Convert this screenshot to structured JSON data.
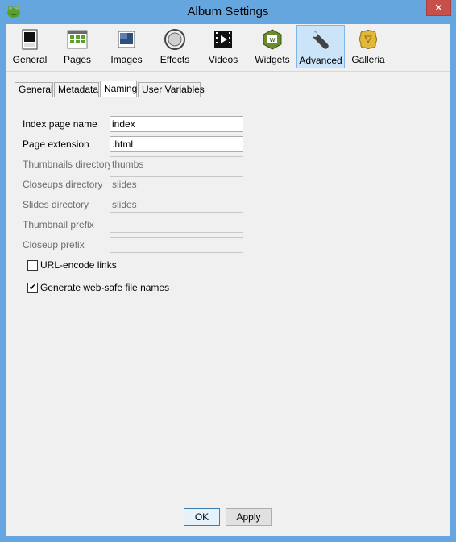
{
  "window": {
    "title": "Album Settings",
    "close_symbol": "✕",
    "icon": "frog-app-icon"
  },
  "toolbar": {
    "items": [
      {
        "label": "General",
        "icon": "general-page-icon",
        "active": false
      },
      {
        "label": "Pages",
        "icon": "pages-grid-icon",
        "active": false
      },
      {
        "label": "Images",
        "icon": "images-icon",
        "active": false
      },
      {
        "label": "Effects",
        "icon": "effects-circles-icon",
        "active": false
      },
      {
        "label": "Videos",
        "icon": "video-film-icon",
        "active": false
      },
      {
        "label": "Widgets",
        "icon": "widgets-icon",
        "active": false
      },
      {
        "label": "Advanced",
        "icon": "advanced-wrench-icon",
        "active": true
      },
      {
        "label": "Galleria",
        "icon": "galleria-icon",
        "active": false
      }
    ]
  },
  "tabs": [
    "General",
    "Metadata",
    "Naming",
    "User Variables"
  ],
  "active_tab": "Naming",
  "form": {
    "fields": [
      {
        "label": "Index page name",
        "value": "index",
        "enabled": true
      },
      {
        "label": "Page extension",
        "value": ".html",
        "enabled": true
      },
      {
        "label": "Thumbnails directory",
        "value": "thumbs",
        "enabled": false
      },
      {
        "label": "Closeups directory",
        "value": "slides",
        "enabled": false
      },
      {
        "label": "Slides directory",
        "value": "slides",
        "enabled": false
      },
      {
        "label": "Thumbnail prefix",
        "value": "",
        "enabled": false
      },
      {
        "label": "Closeup prefix",
        "value": "",
        "enabled": false
      }
    ],
    "checkboxes": [
      {
        "label": "URL-encode links",
        "checked": false
      },
      {
        "label": "Generate web-safe file names",
        "checked": true
      }
    ]
  },
  "buttons": {
    "ok": "OK",
    "apply": "Apply"
  },
  "check_mark": "✔"
}
